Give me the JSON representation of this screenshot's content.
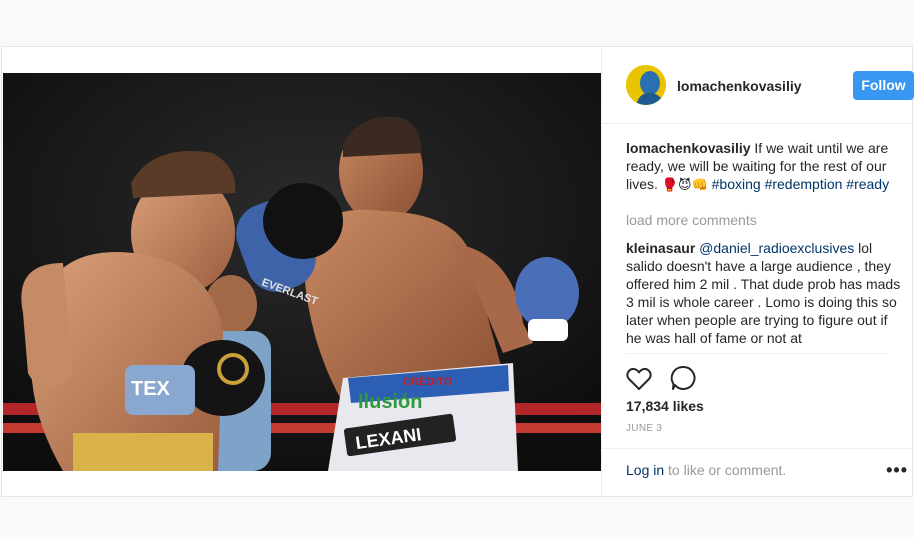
{
  "post": {
    "username": "lomachenkovasiliy",
    "follow_label": "Follow",
    "caption_user": "lomachenkovasiliy",
    "caption_text": " If we wait until we are ready, we will be waiting for the rest of our lives. ",
    "caption_emojis": "🥊😈👊",
    "hashtags": [
      "#boxing",
      "#redemption",
      "#ready"
    ],
    "load_more": "load more comments",
    "comment_user": "kleinasaur",
    "comment_mention": "@daniel_radioexclusives",
    "comment_text": " lol salido doesn't have a large audience , they offered him 2 mil . That dude prob has mads 3 mil is whole career . Lomo is doing this so later when people are trying to figure out if he was hall of fame or not at",
    "likes": "17,834 likes",
    "date": "JUNE 3",
    "login_link": "Log in",
    "login_rest": " to like or comment.",
    "more_label": "•••"
  },
  "photo": {
    "trunk_text_1": "CRÉDITO",
    "trunk_text_2": "Ilusión",
    "trunk_text_3": "LEXANI",
    "glove_text": "EVERLAST",
    "trunk_left_text": "TEX"
  },
  "colors": {
    "follow_bg": "#3897f0",
    "hashtag": "#003569",
    "muted": "#999999"
  },
  "icons": [
    "heart-icon",
    "comment-icon",
    "more-options-icon",
    "avatar-icon"
  ]
}
